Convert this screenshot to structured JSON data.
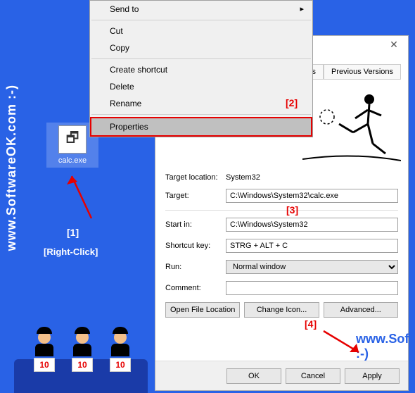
{
  "watermark": "www.SoftwareOK.com :-)",
  "desktop": {
    "icon_label": "calc.exe"
  },
  "context_menu": {
    "send_to": "Send to",
    "cut": "Cut",
    "copy": "Copy",
    "create_shortcut": "Create shortcut",
    "delete": "Delete",
    "rename": "Rename",
    "properties": "Properties"
  },
  "dialog": {
    "tabs": {
      "details": "ails",
      "previous": "Previous Versions"
    },
    "target_location_label": "Target location:",
    "target_location_value": "System32",
    "target_label": "Target:",
    "target_value": "C:\\Windows\\System32\\calc.exe",
    "startin_label": "Start in:",
    "startin_value": "C:\\Windows\\System32",
    "shortcut_label": "Shortcut key:",
    "shortcut_value": "STRG + ALT + C",
    "run_label": "Run:",
    "run_value": "Normal window",
    "comment_label": "Comment:",
    "comment_value": "",
    "open_location": "Open File Location",
    "change_icon": "Change Icon...",
    "advanced": "Advanced...",
    "ok": "OK",
    "cancel": "Cancel",
    "apply": "Apply"
  },
  "annotations": {
    "a1": "[1]",
    "rc": "[Right-Click]",
    "a2": "[2]",
    "a3": "[3]",
    "a4": "[4]"
  },
  "judges": {
    "score": "10"
  }
}
